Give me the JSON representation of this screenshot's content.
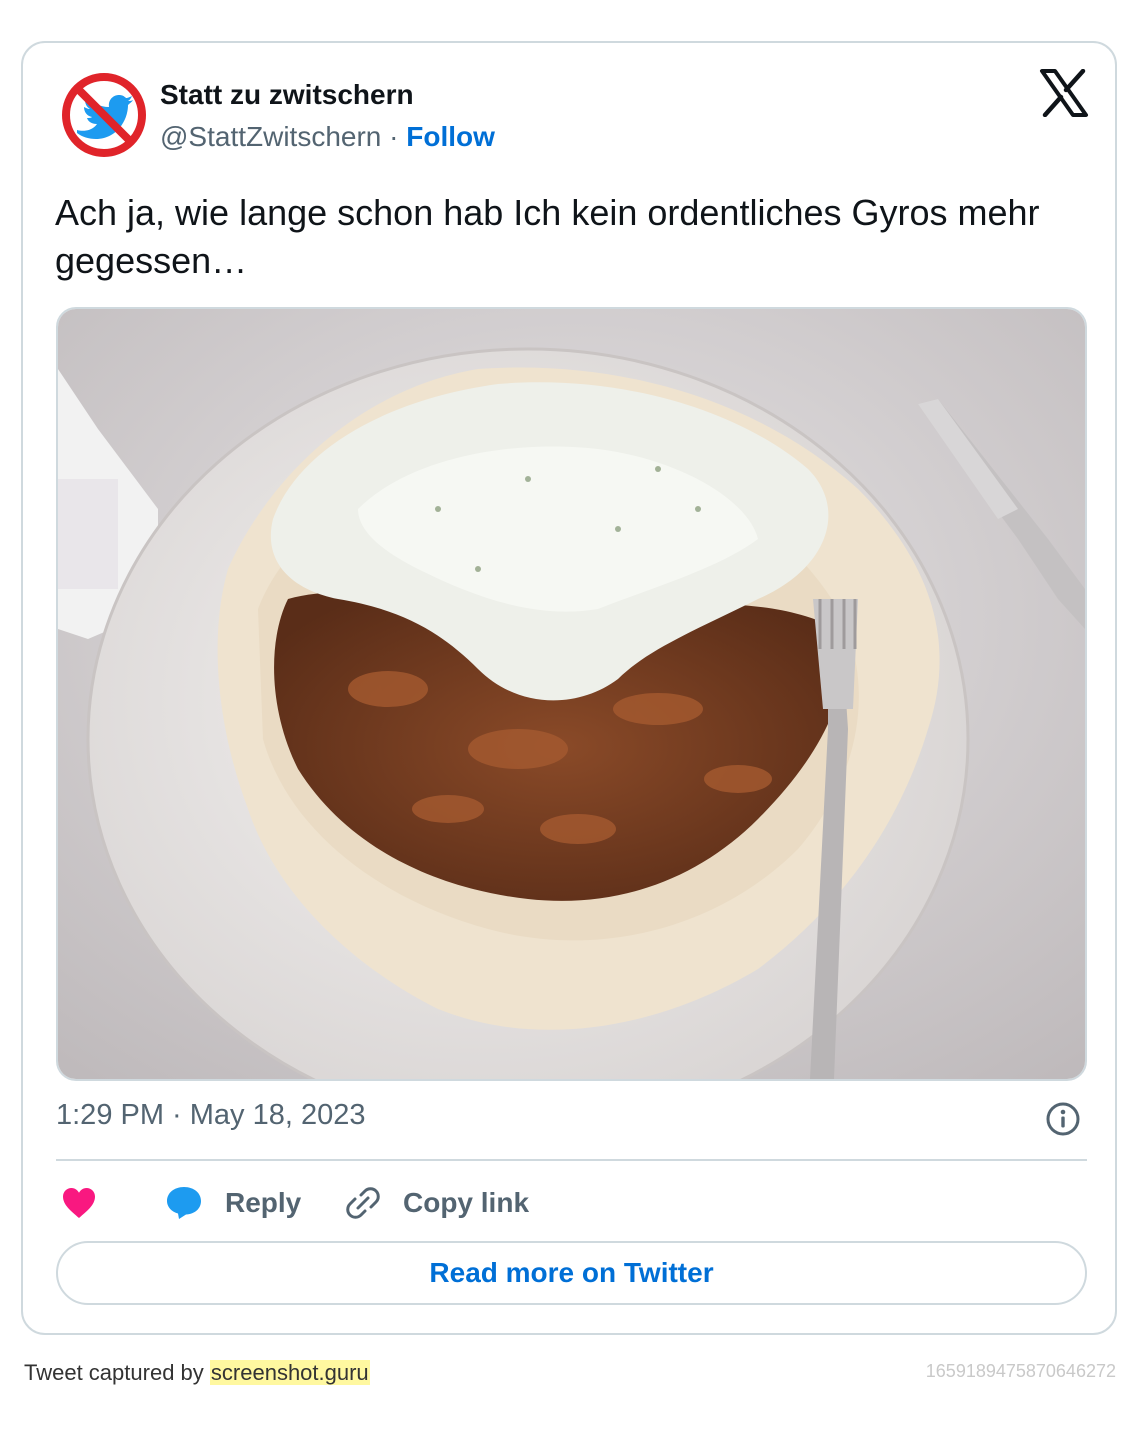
{
  "tweet": {
    "author_name": "Statt zu zwitschern",
    "handle": "@StattZwitschern",
    "separator": "·",
    "follow_label": "Follow",
    "text": "Ach ja, wie lange schon hab Ich kein ordentliches Gyros mehr gegessen…",
    "timestamp": "1:29 PM · May 18, 2023",
    "image_description_icon": "photo-of-gyros-plate"
  },
  "actions": {
    "like_icon": "heart-icon",
    "reply_label": "Reply",
    "copy_link_label": "Copy link"
  },
  "read_more_label": "Read more on Twitter",
  "footer": {
    "captured_prefix": "Tweet captured by",
    "captured_site": "screenshot.guru",
    "tweet_id": "1659189475870646272"
  },
  "colors": {
    "link_blue": "#006fd6",
    "heart_pink": "#f91880",
    "reply_blue": "#1d9bf0",
    "muted_gray": "#536471",
    "border": "#cfd9de"
  }
}
